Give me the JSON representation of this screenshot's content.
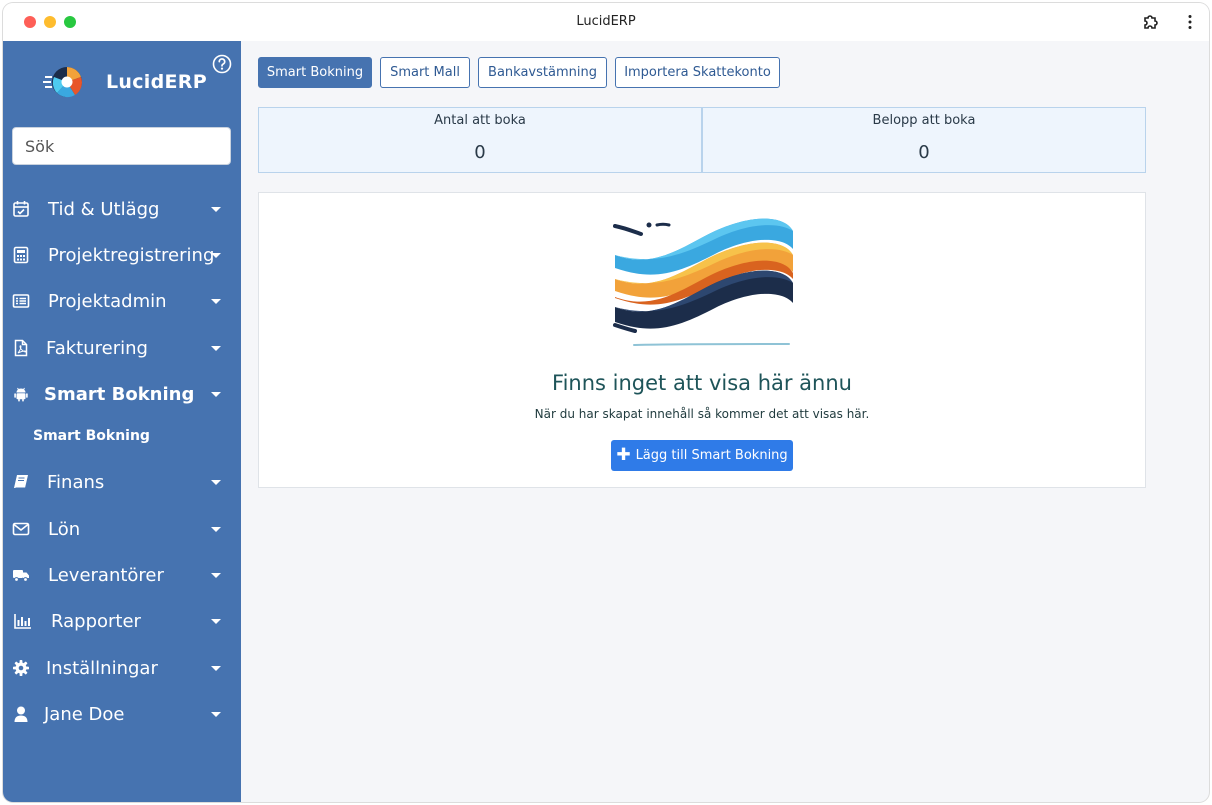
{
  "window": {
    "title": "LucidERP"
  },
  "sidebar": {
    "logo_text": "LucidERP",
    "search_placeholder": "Sök",
    "items": [
      {
        "label": "Tid & Utlägg",
        "icon": "calendar-check-icon"
      },
      {
        "label": "Projektregistrering",
        "icon": "calculator-icon"
      },
      {
        "label": "Projektadmin",
        "icon": "list-icon"
      },
      {
        "label": "Fakturering",
        "icon": "pdf-file-icon"
      },
      {
        "label": "Smart Bokning",
        "icon": "android-icon",
        "active": true
      },
      {
        "label": "Finans",
        "icon": "book-icon"
      },
      {
        "label": "Lön",
        "icon": "envelope-icon"
      },
      {
        "label": "Leverantörer",
        "icon": "truck-icon"
      },
      {
        "label": "Rapporter",
        "icon": "bar-chart-icon"
      },
      {
        "label": "Inställningar",
        "icon": "gear-icon"
      },
      {
        "label": "Jane Doe",
        "icon": "user-icon"
      }
    ],
    "sub_item": "Smart Bokning"
  },
  "tabs": [
    {
      "label": "Smart Bokning",
      "active": true
    },
    {
      "label": "Smart Mall"
    },
    {
      "label": "Bankavstämning"
    },
    {
      "label": "Importera Skattekonto"
    }
  ],
  "stats": [
    {
      "label": "Antal att boka",
      "value": "0"
    },
    {
      "label": "Belopp att boka",
      "value": "0"
    }
  ],
  "empty_state": {
    "title": "Finns inget att visa här ännu",
    "subtitle": "När du har skapat innehåll så kommer det att visas här.",
    "button_label": "Lägg till Smart Bokning"
  },
  "colors": {
    "sidebar": "#4673b0",
    "primary_button": "#2f7be8",
    "stat_background": "#eef5fd"
  }
}
